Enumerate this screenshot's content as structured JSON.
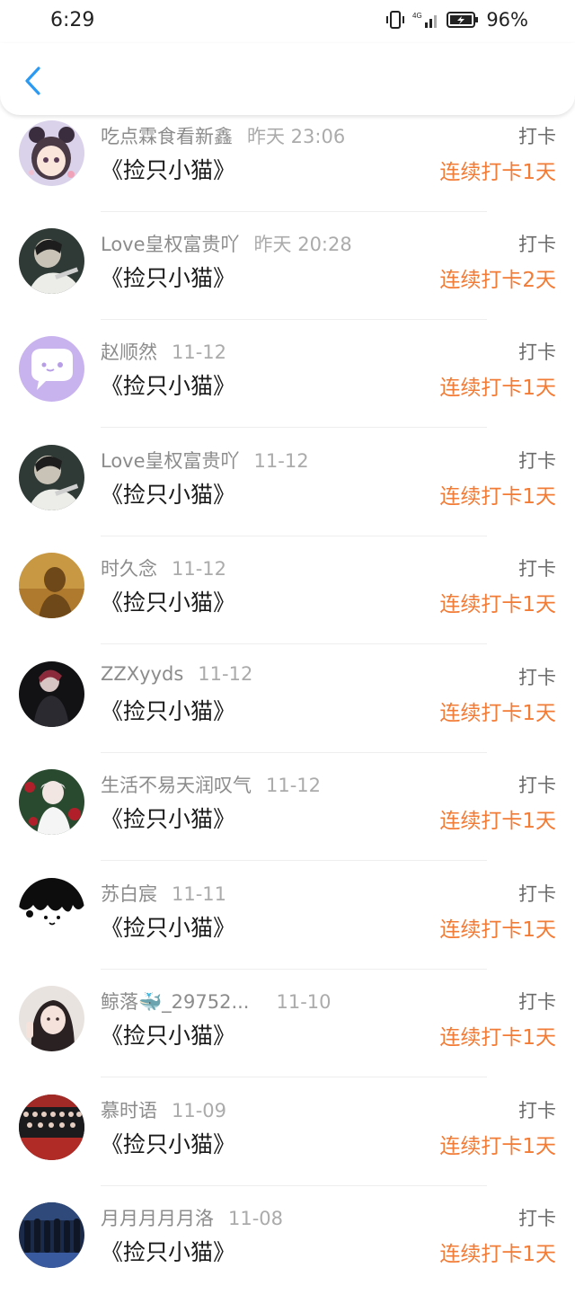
{
  "status_bar": {
    "time": "6:29",
    "network": "4G",
    "battery": "96%",
    "icons": [
      "vibrate-icon",
      "signal-icon",
      "battery-icon"
    ]
  },
  "header": {
    "back_icon": "chevron-left-icon",
    "accent_color": "#2b9af3"
  },
  "colors": {
    "streak": "#f27b35",
    "name": "#8c8c8c",
    "date": "#ababab",
    "title": "#1a1a1a"
  },
  "items": [
    {
      "name": "吃点霖食看新鑫",
      "date": "昨天 23:06",
      "title": "《捡只小猫》",
      "action": "打卡",
      "streak": "连续打卡1天"
    },
    {
      "name": "Love皇权富贵吖",
      "date": "昨天 20:28",
      "title": "《捡只小猫》",
      "action": "打卡",
      "streak": "连续打卡2天"
    },
    {
      "name": "赵顺然",
      "date": "11-12",
      "title": "《捡只小猫》",
      "action": "打卡",
      "streak": "连续打卡1天"
    },
    {
      "name": "Love皇权富贵吖",
      "date": "11-12",
      "title": "《捡只小猫》",
      "action": "打卡",
      "streak": "连续打卡1天"
    },
    {
      "name": "时久念",
      "date": "11-12",
      "title": "《捡只小猫》",
      "action": "打卡",
      "streak": "连续打卡1天"
    },
    {
      "name": "ZZXyyds",
      "date": "11-12",
      "title": "《捡只小猫》",
      "action": "打卡",
      "streak": "连续打卡1天"
    },
    {
      "name": "生活不易天润叹气",
      "date": "11-12",
      "title": "《捡只小猫》",
      "action": "打卡",
      "streak": "连续打卡1天"
    },
    {
      "name": "苏白宸",
      "date": "11-11",
      "title": "《捡只小猫》",
      "action": "打卡",
      "streak": "连续打卡1天"
    },
    {
      "name": "鲸落🐳_29752...",
      "date": "11-10",
      "title": "《捡只小猫》",
      "action": "打卡",
      "streak": "连续打卡1天"
    },
    {
      "name": "慕时语",
      "date": "11-09",
      "title": "《捡只小猫》",
      "action": "打卡",
      "streak": "连续打卡1天"
    },
    {
      "name": "月月月月月洛",
      "date": "11-08",
      "title": "《捡只小猫》",
      "action": "打卡",
      "streak": "连续打卡1天"
    }
  ]
}
